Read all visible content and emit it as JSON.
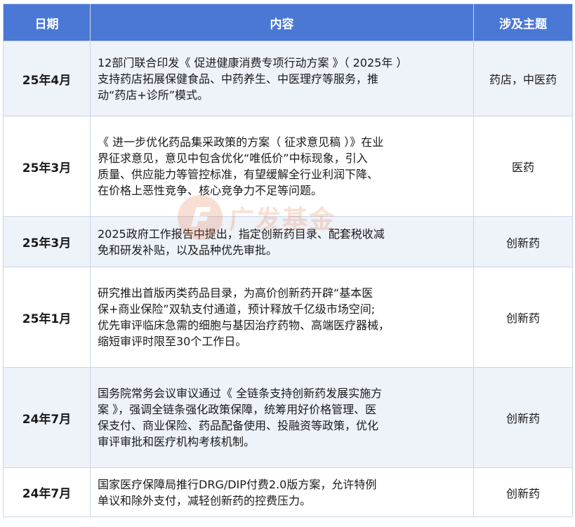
{
  "headers": {
    "date": "日期",
    "content": "内容",
    "topic": "涉及主题"
  },
  "rows": [
    {
      "date": "25年4月",
      "lines": [
        "12部门联合印发《 促进健康消费专项行动方案 》（ 2025年 ）",
        "支持药店拓展保健食品、中药养生、中医理疗等服务，推",
        "动“药店+诊所”模式。"
      ],
      "topic": "药店，中医药"
    },
    {
      "date": "25年3月",
      "lines": [
        "《 进一步优化药品集采政策的方案（ 征求意见稿 ）》在业",
        "界征求意见，意见中包含优化“唯低价”中标现象，引入",
        "质量、供应能力等管控标准，有望缓解全行业利润下降、",
        "在价格上恶性竞争、核心竞争力不足等问题。"
      ],
      "topic": "医药"
    },
    {
      "date": "25年3月",
      "lines": [
        "2025政府工作报告中提出，指定创新药目录、配套税收减",
        "免和研发补贴，以及品种优先审批。"
      ],
      "topic": "创新药"
    },
    {
      "date": "25年1月",
      "lines": [
        "研究推出首版丙类药品目录，为高价创新药开辟“基本医",
        "保+商业保险”双轨支付通道，预计释放千亿级市场空间;",
        "优先审评临床急需的细胞与基因治疗药物、高端医疗器械，",
        "缩短审评时限至30个工作日。"
      ],
      "topic": "创新药"
    },
    {
      "date": "24年7月",
      "lines": [
        "国务院常务会议审议通过《 全链条支持创新药发展实施方",
        "案 》，强调全链条强化政策保障，统筹用好价格管理、医",
        "保支付、商业保险、药品配备使用、投融资等政策，优化",
        "审评审批和医疗机构考核机制。"
      ],
      "topic": "创新药"
    },
    {
      "date": "24年7月",
      "lines": [
        "国家医疗保障局推行DRG/DIP付费2.0版方案，允许特例",
        "单议和除外支付，减轻创新药的控费压力。"
      ],
      "topic": "创新药"
    }
  ],
  "watermark": {
    "text": "广发基金",
    "color": "#e8703a"
  }
}
